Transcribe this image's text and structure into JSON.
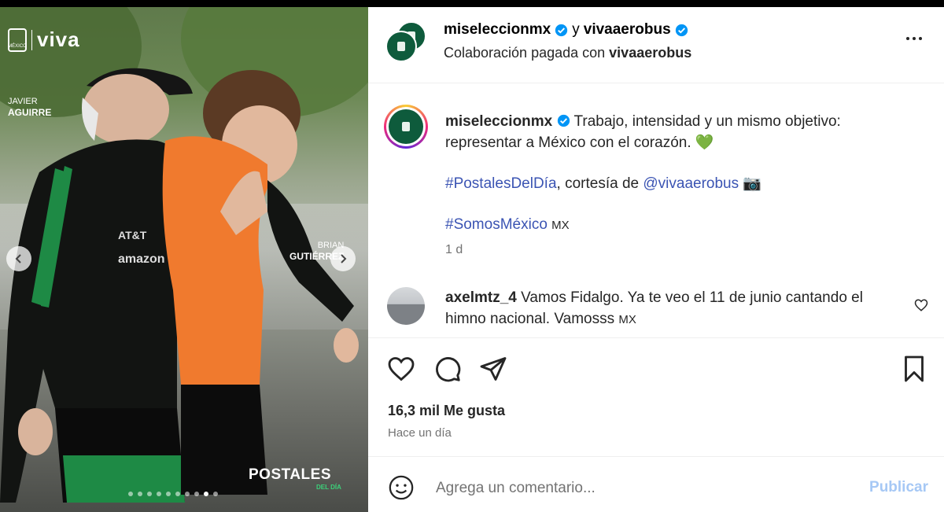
{
  "media": {
    "brand_name": "viva",
    "brand_badge": "MÉXICO",
    "tag_left_first": "JAVIER",
    "tag_left_last": "AGUIRRE",
    "tag_right_first": "BRIAN",
    "tag_right_last": "GUTIÉRREZ",
    "postales_title": "POSTALES",
    "postales_sub": "DEL DÍA",
    "slide_count": 10,
    "active_slide": 9
  },
  "header": {
    "account1": "miseleccionmx",
    "connector": "y",
    "account2": "vivaaerobus",
    "collab_prefix": "Colaboración pagada con",
    "collab_account": "vivaaerobus"
  },
  "caption": {
    "username": "miseleccionmx",
    "text_line1": "Trabajo, intensidad y un mismo objetivo:",
    "text_line2": "representar a México con el corazón. 💚",
    "hashtag1": "#PostalesDelDía",
    "courtesy": ", cortesía de",
    "mention": "@vivaaerobus",
    "camera": "📷",
    "hashtag2": "#SomosMéxico",
    "flag": "MX",
    "time": "1 d"
  },
  "comment": {
    "username": "axelmtz_4",
    "text_line1": "Vamos Fidalgo. Ya te veo el 11 de junio cantando el",
    "text_line2": "himno nacional. Vamosss",
    "flag": "MX"
  },
  "stats": {
    "likes": "16,3 mil Me gusta",
    "posted": "Hace un día"
  },
  "composer": {
    "placeholder": "Agrega un comentario...",
    "publish": "Publicar"
  },
  "colors": {
    "verified": "#0095f6",
    "link": "#3b54b3",
    "publish_disabled": "#a6c8f5",
    "brand_green": "#0e5b3c"
  }
}
